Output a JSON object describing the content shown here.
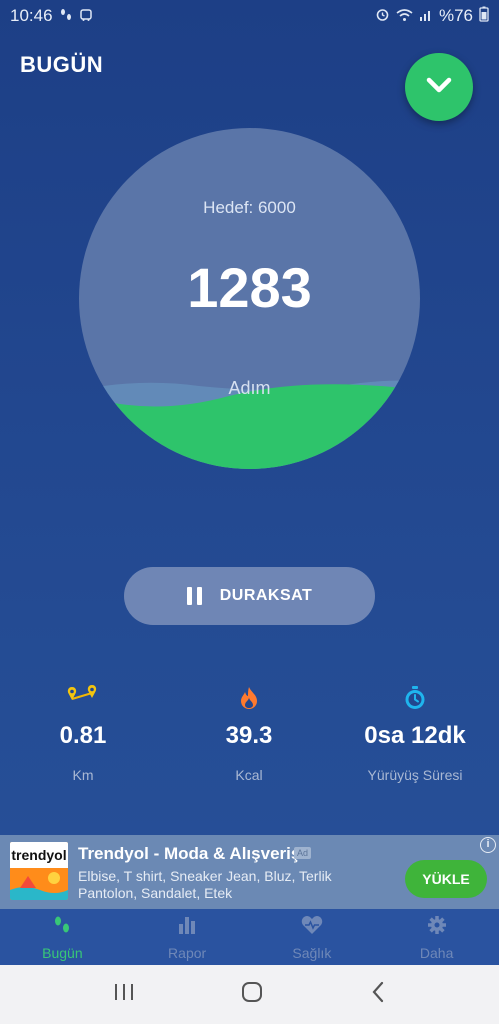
{
  "status_bar": {
    "time": "10:46",
    "battery": "%76",
    "left_icons": [
      "footsteps-icon",
      "bus-icon"
    ],
    "right_icons": [
      "alarm-icon",
      "wifi-icon",
      "signal-icon"
    ]
  },
  "header": {
    "title": "BUGÜN",
    "fab_icon": "chevron-down-icon",
    "fab_color": "#2ec46b"
  },
  "progress": {
    "goal_label": "Hedef: 6000",
    "steps": "1283",
    "unit": "Adım",
    "fill_fraction": 0.214,
    "fill_color": "#2ec46b"
  },
  "pause_button": {
    "label": "DURAKSAT",
    "icon": "pause-icon"
  },
  "stats": [
    {
      "icon": "route-icon",
      "value": "0.81",
      "label": "Km"
    },
    {
      "icon": "flame-icon",
      "value": "39.3",
      "label": "Kcal"
    },
    {
      "icon": "stopwatch-icon",
      "value": "0sa 12dk",
      "label": "Yürüyüş Süresi"
    }
  ],
  "ad": {
    "brand": "trendyol",
    "title": "Trendyol - Moda & Alışveriş",
    "badge": "Ad",
    "description": "Elbise, T shirt, Sneaker Jean, Bluz, Terlik Pantolon, Sandalet, Etek",
    "cta": "YÜKLE",
    "info": "i"
  },
  "bottom_nav": [
    {
      "label": "Bugün",
      "icon": "footsteps-icon",
      "active": true
    },
    {
      "label": "Rapor",
      "icon": "bar-chart-icon",
      "active": false
    },
    {
      "label": "Sağlık",
      "icon": "heart-icon",
      "active": false
    },
    {
      "label": "Daha",
      "icon": "gear-icon",
      "active": false
    }
  ],
  "system_nav": [
    "recents-icon",
    "home-icon",
    "back-icon"
  ],
  "colors": {
    "accent_green": "#2ec46b",
    "background": "#22478f",
    "nav_active": "#38c777",
    "nav_inactive": "#6f88b8"
  }
}
